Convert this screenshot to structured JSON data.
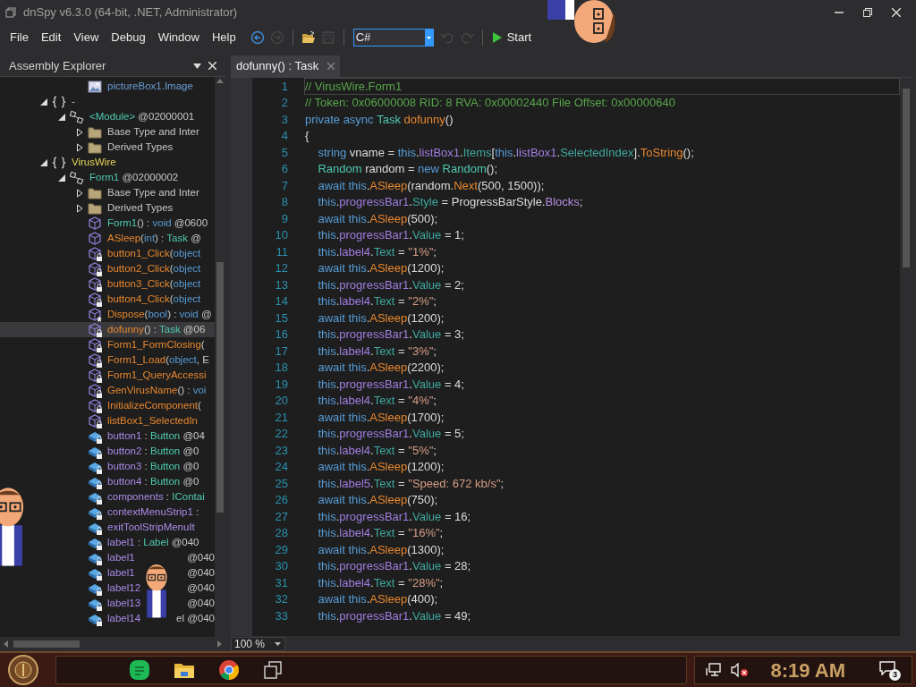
{
  "window": {
    "title": "dnSpy v6.3.0 (64-bit, .NET, Administrator)"
  },
  "menu": [
    "File",
    "Edit",
    "View",
    "Debug",
    "Window",
    "Help"
  ],
  "toolbar": {
    "buttons": [
      {
        "kind": "back",
        "disabled": false
      },
      {
        "kind": "forward",
        "disabled": true
      },
      {
        "kind": "separator"
      },
      {
        "kind": "open"
      },
      {
        "kind": "save",
        "disabled": true
      },
      {
        "kind": "separator"
      },
      {
        "kind": "language"
      },
      {
        "kind": "undo",
        "disabled": true
      },
      {
        "kind": "redo",
        "disabled": true
      },
      {
        "kind": "separator"
      },
      {
        "kind": "start"
      }
    ],
    "language": "C#",
    "start": "Start"
  },
  "explorer": {
    "title": "Assembly Explorer",
    "items": [
      {
        "kind": "resource",
        "selected": false,
        "segments": [
          {
            "kind": "resource",
            "text": "pictureBox1.Image"
          }
        ]
      },
      {
        "kind": "namespace",
        "selected": false,
        "expanded": true,
        "segments": [
          {
            "kind": "plain",
            "text": "-"
          }
        ],
        "children": [
          {
            "kind": "class",
            "selected": false,
            "expanded": true,
            "segments": [
              {
                "kind": "type",
                "text": "<Module>"
              },
              {
                "kind": "meta",
                "text": " @02000001"
              }
            ],
            "children": [
              {
                "kind": "folder",
                "selected": false,
                "expanded": false,
                "segments": [
                  {
                    "kind": "plain",
                    "text": "Base Type and Inter"
                  }
                ]
              },
              {
                "kind": "folder",
                "selected": false,
                "expanded": false,
                "segments": [
                  {
                    "kind": "plain",
                    "text": "Derived Types"
                  }
                ]
              }
            ]
          }
        ]
      },
      {
        "kind": "namespace",
        "selected": false,
        "expanded": true,
        "segments": [
          {
            "kind": "namespace",
            "text": "VirusWire"
          }
        ],
        "children": [
          {
            "kind": "class",
            "selected": false,
            "expanded": true,
            "segments": [
              {
                "kind": "type",
                "text": "Form1"
              },
              {
                "kind": "meta",
                "text": " @02000002"
              }
            ],
            "children": [
              {
                "kind": "folder",
                "selected": false,
                "expanded": false,
                "segments": [
                  {
                    "kind": "plain",
                    "text": "Base Type and Inter"
                  }
                ]
              },
              {
                "kind": "folder",
                "selected": false,
                "expanded": false,
                "segments": [
                  {
                    "kind": "plain",
                    "text": "Derived Types"
                  }
                ]
              },
              {
                "kind": "method",
                "selected": false,
                "segments": [
                  {
                    "kind": "ctor",
                    "text": "Form1"
                  },
                  {
                    "kind": "plain",
                    "text": "() : "
                  },
                  {
                    "kind": "keyword",
                    "text": "void"
                  },
                  {
                    "kind": "meta",
                    "text": " @0600"
                  }
                ]
              },
              {
                "kind": "method",
                "selected": false,
                "segments": [
                  {
                    "kind": "method",
                    "text": "ASleep"
                  },
                  {
                    "kind": "plain",
                    "text": "("
                  },
                  {
                    "kind": "keyword",
                    "text": "int"
                  },
                  {
                    "kind": "plain",
                    "text": ") : "
                  },
                  {
                    "kind": "type",
                    "text": "Task"
                  },
                  {
                    "kind": "meta",
                    "text": " @"
                  }
                ]
              },
              {
                "kind": "private-method",
                "selected": false,
                "segments": [
                  {
                    "kind": "method",
                    "text": "button1_Click"
                  },
                  {
                    "kind": "plain",
                    "text": "("
                  },
                  {
                    "kind": "keyword",
                    "text": "object"
                  }
                ]
              },
              {
                "kind": "private-method",
                "selected": false,
                "segments": [
                  {
                    "kind": "method",
                    "text": "button2_Click"
                  },
                  {
                    "kind": "plain",
                    "text": "("
                  },
                  {
                    "kind": "keyword",
                    "text": "object"
                  }
                ]
              },
              {
                "kind": "private-method",
                "selected": false,
                "segments": [
                  {
                    "kind": "method",
                    "text": "button3_Click"
                  },
                  {
                    "kind": "plain",
                    "text": "("
                  },
                  {
                    "kind": "keyword",
                    "text": "object"
                  }
                ]
              },
              {
                "kind": "private-method",
                "selected": false,
                "segments": [
                  {
                    "kind": "method",
                    "text": "button4_Click"
                  },
                  {
                    "kind": "plain",
                    "text": "("
                  },
                  {
                    "kind": "keyword",
                    "text": "object"
                  }
                ]
              },
              {
                "kind": "protected-method",
                "selected": false,
                "segments": [
                  {
                    "kind": "method",
                    "text": "Dispose"
                  },
                  {
                    "kind": "plain",
                    "text": "("
                  },
                  {
                    "kind": "keyword",
                    "text": "bool"
                  },
                  {
                    "kind": "plain",
                    "text": ") : "
                  },
                  {
                    "kind": "keyword",
                    "text": "void"
                  },
                  {
                    "kind": "meta",
                    "text": " @"
                  }
                ]
              },
              {
                "kind": "private-method",
                "selected": true,
                "segments": [
                  {
                    "kind": "method",
                    "text": "dofunny"
                  },
                  {
                    "kind": "plain",
                    "text": "() : "
                  },
                  {
                    "kind": "type",
                    "text": "Task"
                  },
                  {
                    "kind": "meta",
                    "text": " @06"
                  }
                ]
              },
              {
                "kind": "private-method",
                "selected": false,
                "segments": [
                  {
                    "kind": "method",
                    "text": "Form1_FormClosing"
                  },
                  {
                    "kind": "plain",
                    "text": "("
                  }
                ]
              },
              {
                "kind": "private-method",
                "selected": false,
                "segments": [
                  {
                    "kind": "method",
                    "text": "Form1_Load"
                  },
                  {
                    "kind": "plain",
                    "text": "("
                  },
                  {
                    "kind": "keyword",
                    "text": "object"
                  },
                  {
                    "kind": "plain",
                    "text": ", E"
                  }
                ]
              },
              {
                "kind": "private-method",
                "selected": false,
                "segments": [
                  {
                    "kind": "method",
                    "text": "Form1_QueryAccessi"
                  }
                ]
              },
              {
                "kind": "private-method",
                "selected": false,
                "segments": [
                  {
                    "kind": "method",
                    "text": "GenVirusName"
                  },
                  {
                    "kind": "plain",
                    "text": "() : "
                  },
                  {
                    "kind": "keyword",
                    "text": "voi"
                  }
                ]
              },
              {
                "kind": "private-method",
                "selected": false,
                "segments": [
                  {
                    "kind": "method",
                    "text": "InitializeComponent"
                  },
                  {
                    "kind": "plain",
                    "text": "("
                  }
                ]
              },
              {
                "kind": "private-method",
                "selected": false,
                "segments": [
                  {
                    "kind": "method",
                    "text": "listBox1_SelectedIn"
                  }
                ]
              },
              {
                "kind": "field",
                "selected": false,
                "segments": [
                  {
                    "kind": "field",
                    "text": "button1"
                  },
                  {
                    "kind": "plain",
                    "text": " : "
                  },
                  {
                    "kind": "type",
                    "text": "Button"
                  },
                  {
                    "kind": "meta",
                    "text": " @04"
                  }
                ]
              },
              {
                "kind": "field",
                "selected": false,
                "segments": [
                  {
                    "kind": "field",
                    "text": "button2"
                  },
                  {
                    "kind": "plain",
                    "text": " : "
                  },
                  {
                    "kind": "type",
                    "text": "Button"
                  },
                  {
                    "kind": "meta",
                    "text": " @0"
                  }
                ]
              },
              {
                "kind": "field",
                "selected": false,
                "segments": [
                  {
                    "kind": "field",
                    "text": "button3"
                  },
                  {
                    "kind": "plain",
                    "text": " : "
                  },
                  {
                    "kind": "type",
                    "text": "Button"
                  },
                  {
                    "kind": "meta",
                    "text": " @0"
                  }
                ]
              },
              {
                "kind": "field",
                "selected": false,
                "segments": [
                  {
                    "kind": "field",
                    "text": "button4"
                  },
                  {
                    "kind": "plain",
                    "text": " : "
                  },
                  {
                    "kind": "type",
                    "text": "Button"
                  },
                  {
                    "kind": "meta",
                    "text": " @0"
                  }
                ]
              },
              {
                "kind": "field",
                "selected": false,
                "segments": [
                  {
                    "kind": "field",
                    "text": "components"
                  },
                  {
                    "kind": "plain",
                    "text": " : "
                  },
                  {
                    "kind": "type",
                    "text": "IContai"
                  }
                ]
              },
              {
                "kind": "field",
                "selected": false,
                "segments": [
                  {
                    "kind": "field",
                    "text": "contextMenuStrip1"
                  },
                  {
                    "kind": "plain",
                    "text": " :"
                  }
                ]
              },
              {
                "kind": "field",
                "selected": false,
                "segments": [
                  {
                    "kind": "field",
                    "text": "exitToolStripMenuIt"
                  }
                ]
              },
              {
                "kind": "field",
                "selected": false,
                "segments": [
                  {
                    "kind": "field",
                    "text": "label1"
                  },
                  {
                    "kind": "plain",
                    "text": " : "
                  },
                  {
                    "kind": "type",
                    "text": "Label"
                  },
                  {
                    "kind": "meta",
                    "text": " @040"
                  }
                ]
              },
              {
                "kind": "field",
                "selected": false,
                "segments": [
                  {
                    "kind": "field",
                    "text": "label1"
                  },
                  {
                    "kind": "tail",
                    "text": "@040"
                  }
                ]
              },
              {
                "kind": "field",
                "selected": false,
                "segments": [
                  {
                    "kind": "field",
                    "text": "label1"
                  },
                  {
                    "kind": "tail",
                    "text": "@040"
                  }
                ]
              },
              {
                "kind": "field",
                "selected": false,
                "segments": [
                  {
                    "kind": "field",
                    "text": "label12"
                  },
                  {
                    "kind": "tail",
                    "text": "@040"
                  }
                ]
              },
              {
                "kind": "field",
                "selected": false,
                "segments": [
                  {
                    "kind": "field",
                    "text": "label13"
                  },
                  {
                    "kind": "tail",
                    "text": "@040"
                  }
                ]
              },
              {
                "kind": "field",
                "selected": false,
                "segments": [
                  {
                    "kind": "field",
                    "text": "label14"
                  },
                  {
                    "kind": "tail",
                    "text": "el @040"
                  }
                ]
              }
            ]
          }
        ]
      }
    ]
  },
  "tabs": [
    {
      "label": "dofunny() : Task",
      "selected": true
    }
  ],
  "code": [
    {
      "number": "1",
      "selected": true,
      "tokens": [
        {
          "kind": "comment",
          "text": "// VirusWire.Form1"
        }
      ]
    },
    {
      "number": "2",
      "selected": false,
      "tokens": [
        {
          "kind": "comment",
          "text": "// Token: 0x06000008 RID: 8 RVA: 0x00002440 File Offset: 0x00000640"
        }
      ]
    },
    {
      "number": "3",
      "selected": false,
      "tokens": [
        {
          "kind": "keyword",
          "text": "private async "
        },
        {
          "kind": "type",
          "text": "Task "
        },
        {
          "kind": "method",
          "text": "dofunny"
        },
        {
          "kind": "plain",
          "text": "()"
        }
      ]
    },
    {
      "number": "4",
      "selected": false,
      "tokens": [
        {
          "kind": "plain",
          "text": "{"
        }
      ]
    },
    {
      "number": "5",
      "selected": false,
      "tokens": [
        {
          "kind": "keyword",
          "text": "    string "
        },
        {
          "kind": "plain",
          "text": "vname = "
        },
        {
          "kind": "keyword",
          "text": "this"
        },
        {
          "kind": "plain",
          "text": "."
        },
        {
          "kind": "field",
          "text": "listBox1"
        },
        {
          "kind": "plain",
          "text": "."
        },
        {
          "kind": "property",
          "text": "Items"
        },
        {
          "kind": "plain",
          "text": "["
        },
        {
          "kind": "keyword",
          "text": "this"
        },
        {
          "kind": "plain",
          "text": "."
        },
        {
          "kind": "field",
          "text": "listBox1"
        },
        {
          "kind": "plain",
          "text": "."
        },
        {
          "kind": "property",
          "text": "SelectedIndex"
        },
        {
          "kind": "plain",
          "text": "]."
        },
        {
          "kind": "method",
          "text": "ToString"
        },
        {
          "kind": "plain",
          "text": "();"
        }
      ]
    },
    {
      "number": "6",
      "selected": false,
      "tokens": [
        {
          "kind": "type",
          "text": "    Random "
        },
        {
          "kind": "plain",
          "text": "random = "
        },
        {
          "kind": "keyword",
          "text": "new "
        },
        {
          "kind": "type",
          "text": "Random"
        },
        {
          "kind": "plain",
          "text": "();"
        }
      ]
    },
    {
      "number": "7",
      "selected": false,
      "tokens": [
        {
          "kind": "keyword",
          "text": "    await this"
        },
        {
          "kind": "plain",
          "text": "."
        },
        {
          "kind": "method",
          "text": "ASleep"
        },
        {
          "kind": "plain",
          "text": "(random."
        },
        {
          "kind": "method",
          "text": "Next"
        },
        {
          "kind": "plain",
          "text": "(500, 1500));"
        }
      ]
    },
    {
      "number": "8",
      "selected": false,
      "tokens": [
        {
          "kind": "keyword",
          "text": "    this"
        },
        {
          "kind": "plain",
          "text": "."
        },
        {
          "kind": "field",
          "text": "progressBar1"
        },
        {
          "kind": "plain",
          "text": "."
        },
        {
          "kind": "property",
          "text": "Style"
        },
        {
          "kind": "plain",
          "text": " = ProgressBarStyle."
        },
        {
          "kind": "enum",
          "text": "Blocks"
        },
        {
          "kind": "plain",
          "text": ";"
        }
      ]
    },
    {
      "number": "9",
      "selected": false,
      "tokens": [
        {
          "kind": "keyword",
          "text": "    await this"
        },
        {
          "kind": "plain",
          "text": "."
        },
        {
          "kind": "method",
          "text": "ASleep"
        },
        {
          "kind": "plain",
          "text": "(500);"
        }
      ]
    },
    {
      "number": "10",
      "selected": false,
      "tokens": [
        {
          "kind": "keyword",
          "text": "    this"
        },
        {
          "kind": "plain",
          "text": "."
        },
        {
          "kind": "field",
          "text": "progressBar1"
        },
        {
          "kind": "plain",
          "text": "."
        },
        {
          "kind": "property",
          "text": "Value"
        },
        {
          "kind": "plain",
          "text": " = 1;"
        }
      ]
    },
    {
      "number": "11",
      "selected": false,
      "tokens": [
        {
          "kind": "keyword",
          "text": "    this"
        },
        {
          "kind": "plain",
          "text": "."
        },
        {
          "kind": "field",
          "text": "label4"
        },
        {
          "kind": "plain",
          "text": "."
        },
        {
          "kind": "property",
          "text": "Text"
        },
        {
          "kind": "plain",
          "text": " = "
        },
        {
          "kind": "string",
          "text": "\"1%\""
        },
        {
          "kind": "plain",
          "text": ";"
        }
      ]
    },
    {
      "number": "12",
      "selected": false,
      "tokens": [
        {
          "kind": "keyword",
          "text": "    await this"
        },
        {
          "kind": "plain",
          "text": "."
        },
        {
          "kind": "method",
          "text": "ASleep"
        },
        {
          "kind": "plain",
          "text": "(1200);"
        }
      ]
    },
    {
      "number": "13",
      "selected": false,
      "tokens": [
        {
          "kind": "keyword",
          "text": "    this"
        },
        {
          "kind": "plain",
          "text": "."
        },
        {
          "kind": "field",
          "text": "progressBar1"
        },
        {
          "kind": "plain",
          "text": "."
        },
        {
          "kind": "property",
          "text": "Value"
        },
        {
          "kind": "plain",
          "text": " = 2;"
        }
      ]
    },
    {
      "number": "14",
      "selected": false,
      "tokens": [
        {
          "kind": "keyword",
          "text": "    this"
        },
        {
          "kind": "plain",
          "text": "."
        },
        {
          "kind": "field",
          "text": "label4"
        },
        {
          "kind": "plain",
          "text": "."
        },
        {
          "kind": "property",
          "text": "Text"
        },
        {
          "kind": "plain",
          "text": " = "
        },
        {
          "kind": "string",
          "text": "\"2%\""
        },
        {
          "kind": "plain",
          "text": ";"
        }
      ]
    },
    {
      "number": "15",
      "selected": false,
      "tokens": [
        {
          "kind": "keyword",
          "text": "    await this"
        },
        {
          "kind": "plain",
          "text": "."
        },
        {
          "kind": "method",
          "text": "ASleep"
        },
        {
          "kind": "plain",
          "text": "(1200);"
        }
      ]
    },
    {
      "number": "16",
      "selected": false,
      "tokens": [
        {
          "kind": "keyword",
          "text": "    this"
        },
        {
          "kind": "plain",
          "text": "."
        },
        {
          "kind": "field",
          "text": "progressBar1"
        },
        {
          "kind": "plain",
          "text": "."
        },
        {
          "kind": "property",
          "text": "Value"
        },
        {
          "kind": "plain",
          "text": " = 3;"
        }
      ]
    },
    {
      "number": "17",
      "selected": false,
      "tokens": [
        {
          "kind": "keyword",
          "text": "    this"
        },
        {
          "kind": "plain",
          "text": "."
        },
        {
          "kind": "field",
          "text": "label4"
        },
        {
          "kind": "plain",
          "text": "."
        },
        {
          "kind": "property",
          "text": "Text"
        },
        {
          "kind": "plain",
          "text": " = "
        },
        {
          "kind": "string",
          "text": "\"3%\""
        },
        {
          "kind": "plain",
          "text": ";"
        }
      ]
    },
    {
      "number": "18",
      "selected": false,
      "tokens": [
        {
          "kind": "keyword",
          "text": "    await this"
        },
        {
          "kind": "plain",
          "text": "."
        },
        {
          "kind": "method",
          "text": "ASleep"
        },
        {
          "kind": "plain",
          "text": "(2200);"
        }
      ]
    },
    {
      "number": "19",
      "selected": false,
      "tokens": [
        {
          "kind": "keyword",
          "text": "    this"
        },
        {
          "kind": "plain",
          "text": "."
        },
        {
          "kind": "field",
          "text": "progressBar1"
        },
        {
          "kind": "plain",
          "text": "."
        },
        {
          "kind": "property",
          "text": "Value"
        },
        {
          "kind": "plain",
          "text": " = 4;"
        }
      ]
    },
    {
      "number": "20",
      "selected": false,
      "tokens": [
        {
          "kind": "keyword",
          "text": "    this"
        },
        {
          "kind": "plain",
          "text": "."
        },
        {
          "kind": "field",
          "text": "label4"
        },
        {
          "kind": "plain",
          "text": "."
        },
        {
          "kind": "property",
          "text": "Text"
        },
        {
          "kind": "plain",
          "text": " = "
        },
        {
          "kind": "string",
          "text": "\"4%\""
        },
        {
          "kind": "plain",
          "text": ";"
        }
      ]
    },
    {
      "number": "21",
      "selected": false,
      "tokens": [
        {
          "kind": "keyword",
          "text": "    await this"
        },
        {
          "kind": "plain",
          "text": "."
        },
        {
          "kind": "method",
          "text": "ASleep"
        },
        {
          "kind": "plain",
          "text": "(1700);"
        }
      ]
    },
    {
      "number": "22",
      "selected": false,
      "tokens": [
        {
          "kind": "keyword",
          "text": "    this"
        },
        {
          "kind": "plain",
          "text": "."
        },
        {
          "kind": "field",
          "text": "progressBar1"
        },
        {
          "kind": "plain",
          "text": "."
        },
        {
          "kind": "property",
          "text": "Value"
        },
        {
          "kind": "plain",
          "text": " = 5;"
        }
      ]
    },
    {
      "number": "23",
      "selected": false,
      "tokens": [
        {
          "kind": "keyword",
          "text": "    this"
        },
        {
          "kind": "plain",
          "text": "."
        },
        {
          "kind": "field",
          "text": "label4"
        },
        {
          "kind": "plain",
          "text": "."
        },
        {
          "kind": "property",
          "text": "Text"
        },
        {
          "kind": "plain",
          "text": " = "
        },
        {
          "kind": "string",
          "text": "\"5%\""
        },
        {
          "kind": "plain",
          "text": ";"
        }
      ]
    },
    {
      "number": "24",
      "selected": false,
      "tokens": [
        {
          "kind": "keyword",
          "text": "    await this"
        },
        {
          "kind": "plain",
          "text": "."
        },
        {
          "kind": "method",
          "text": "ASleep"
        },
        {
          "kind": "plain",
          "text": "(1200);"
        }
      ]
    },
    {
      "number": "25",
      "selected": false,
      "tokens": [
        {
          "kind": "keyword",
          "text": "    this"
        },
        {
          "kind": "plain",
          "text": "."
        },
        {
          "kind": "field",
          "text": "label5"
        },
        {
          "kind": "plain",
          "text": "."
        },
        {
          "kind": "property",
          "text": "Text"
        },
        {
          "kind": "plain",
          "text": " = "
        },
        {
          "kind": "string",
          "text": "\"Speed: 672 kb/s\""
        },
        {
          "kind": "plain",
          "text": ";"
        }
      ]
    },
    {
      "number": "26",
      "selected": false,
      "tokens": [
        {
          "kind": "keyword",
          "text": "    await this"
        },
        {
          "kind": "plain",
          "text": "."
        },
        {
          "kind": "method",
          "text": "ASleep"
        },
        {
          "kind": "plain",
          "text": "(750);"
        }
      ]
    },
    {
      "number": "27",
      "selected": false,
      "tokens": [
        {
          "kind": "keyword",
          "text": "    this"
        },
        {
          "kind": "plain",
          "text": "."
        },
        {
          "kind": "field",
          "text": "progressBar1"
        },
        {
          "kind": "plain",
          "text": "."
        },
        {
          "kind": "property",
          "text": "Value"
        },
        {
          "kind": "plain",
          "text": " = 16;"
        }
      ]
    },
    {
      "number": "28",
      "selected": false,
      "tokens": [
        {
          "kind": "keyword",
          "text": "    this"
        },
        {
          "kind": "plain",
          "text": "."
        },
        {
          "kind": "field",
          "text": "label4"
        },
        {
          "kind": "plain",
          "text": "."
        },
        {
          "kind": "property",
          "text": "Text"
        },
        {
          "kind": "plain",
          "text": " = "
        },
        {
          "kind": "string",
          "text": "\"16%\""
        },
        {
          "kind": "plain",
          "text": ";"
        }
      ]
    },
    {
      "number": "29",
      "selected": false,
      "tokens": [
        {
          "kind": "keyword",
          "text": "    await this"
        },
        {
          "kind": "plain",
          "text": "."
        },
        {
          "kind": "method",
          "text": "ASleep"
        },
        {
          "kind": "plain",
          "text": "(1300);"
        }
      ]
    },
    {
      "number": "30",
      "selected": false,
      "tokens": [
        {
          "kind": "keyword",
          "text": "    this"
        },
        {
          "kind": "plain",
          "text": "."
        },
        {
          "kind": "field",
          "text": "progressBar1"
        },
        {
          "kind": "plain",
          "text": "."
        },
        {
          "kind": "property",
          "text": "Value"
        },
        {
          "kind": "plain",
          "text": " = 28;"
        }
      ]
    },
    {
      "number": "31",
      "selected": false,
      "tokens": [
        {
          "kind": "keyword",
          "text": "    this"
        },
        {
          "kind": "plain",
          "text": "."
        },
        {
          "kind": "field",
          "text": "label4"
        },
        {
          "kind": "plain",
          "text": "."
        },
        {
          "kind": "property",
          "text": "Text"
        },
        {
          "kind": "plain",
          "text": " = "
        },
        {
          "kind": "string",
          "text": "\"28%\""
        },
        {
          "kind": "plain",
          "text": ";"
        }
      ]
    },
    {
      "number": "32",
      "selected": false,
      "tokens": [
        {
          "kind": "keyword",
          "text": "    await this"
        },
        {
          "kind": "plain",
          "text": "."
        },
        {
          "kind": "method",
          "text": "ASleep"
        },
        {
          "kind": "plain",
          "text": "(400);"
        }
      ]
    },
    {
      "number": "33",
      "selected": false,
      "tokens": [
        {
          "kind": "keyword",
          "text": "    this"
        },
        {
          "kind": "plain",
          "text": "."
        },
        {
          "kind": "field",
          "text": "progressBar1"
        },
        {
          "kind": "plain",
          "text": "."
        },
        {
          "kind": "property",
          "text": "Value"
        },
        {
          "kind": "plain",
          "text": " = 49;"
        }
      ]
    }
  ],
  "zoom": "100 %",
  "taskbar": {
    "clock": "8:19 AM",
    "notifications": "3"
  }
}
